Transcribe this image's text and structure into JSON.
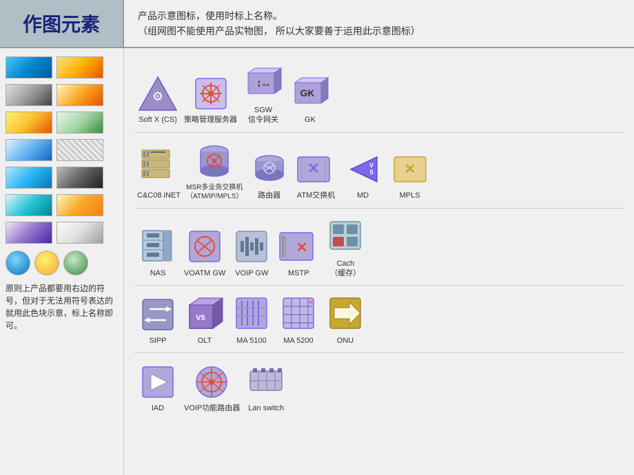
{
  "header": {
    "title": "作图元素",
    "desc_line1": "产品示意图标，使用时标上名称。",
    "desc_line2": "（组网图不能使用产品实物图，  所以大家要善于运用此示意图标）"
  },
  "left_text": "原则上产品都要用右边的符号，但对于无法用符号表达的就用此色块示意，标上名称即可。",
  "icons": [
    {
      "id": "softx",
      "label": "Soft X (CS)"
    },
    {
      "id": "policy",
      "label": "策略管理服务器"
    },
    {
      "id": "sgw",
      "label": "SGW\n信令网关"
    },
    {
      "id": "gk",
      "label": "GK"
    },
    {
      "id": "empty1",
      "label": ""
    },
    {
      "id": "cc08",
      "label": "C&C08 iNET"
    },
    {
      "id": "msr",
      "label": "MSR多业务交换机\n（ATM/IP/MPLS）"
    },
    {
      "id": "router",
      "label": "路由器"
    },
    {
      "id": "atm",
      "label": "ATM交换机"
    },
    {
      "id": "md",
      "label": "MD"
    },
    {
      "id": "mpls",
      "label": "MPLS"
    },
    {
      "id": "nas",
      "label": "NAS"
    },
    {
      "id": "voatm",
      "label": "VOATM GW"
    },
    {
      "id": "voip_gw",
      "label": "VOIP GW"
    },
    {
      "id": "mstp",
      "label": "MSTP"
    },
    {
      "id": "cach",
      "label": "Cach\n（缓存）"
    },
    {
      "id": "sipp",
      "label": "SIPP"
    },
    {
      "id": "olt",
      "label": "OLT"
    },
    {
      "id": "ma5100",
      "label": "MA 5100"
    },
    {
      "id": "ma5200",
      "label": "MA 5200"
    },
    {
      "id": "onu",
      "label": "ONU"
    },
    {
      "id": "iad",
      "label": "IAD"
    },
    {
      "id": "voip_router",
      "label": "VOIP功能路由器"
    },
    {
      "id": "lan_switch",
      "label": "Lan switch"
    },
    {
      "id": "empty2",
      "label": ""
    }
  ]
}
